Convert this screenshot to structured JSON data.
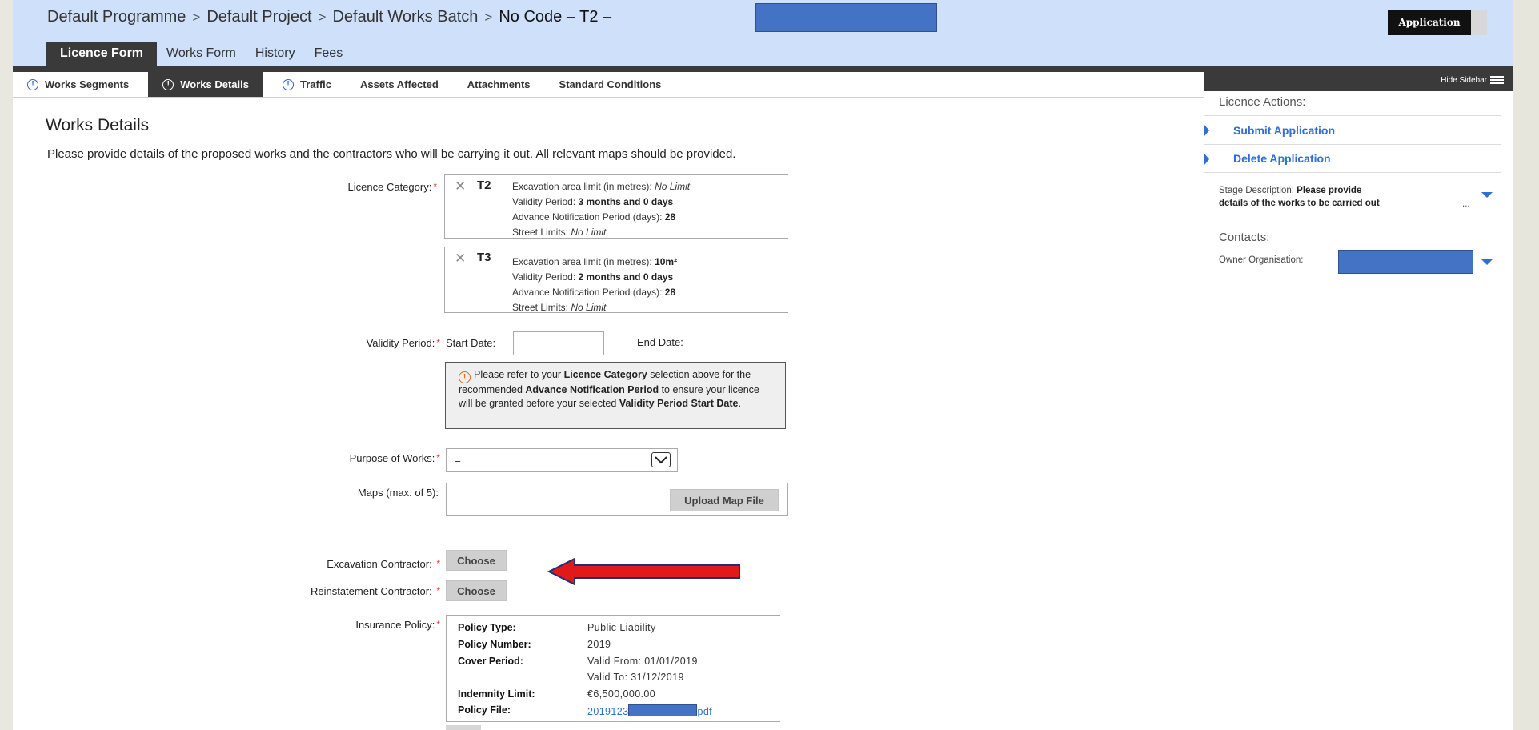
{
  "breadcrumb": {
    "items": [
      "Default Programme",
      "Default Project",
      "Default Works Batch"
    ],
    "current": "No Code – T2 –",
    "separator": ">"
  },
  "header": {
    "badge": "Application"
  },
  "main_tabs": [
    "Licence Form",
    "Works Form",
    "History",
    "Fees"
  ],
  "sub_tabs": [
    {
      "label": "Works Segments",
      "icon": "info-icon"
    },
    {
      "label": "Works Details",
      "icon": "info-icon"
    },
    {
      "label": "Traffic",
      "icon": "info-icon"
    },
    {
      "label": "Assets Affected"
    },
    {
      "label": "Attachments"
    },
    {
      "label": "Standard Conditions"
    }
  ],
  "page": {
    "title": "Works Details",
    "intro": "Please provide details of the proposed works and the contractors who will be carrying it out. All relevant maps should be provided."
  },
  "form": {
    "licence_category_label": "Licence Category:",
    "categories": [
      {
        "code": "T2",
        "excavation_label": "Excavation area limit (in metres):",
        "excavation_value": "No Limit",
        "validity_label": "Validity Period:",
        "validity_value": "3 months and 0 days",
        "advance_label": "Advance Notification Period (days):",
        "advance_value": "28",
        "street_label": "Street Limits:",
        "street_value": "No Limit"
      },
      {
        "code": "T3",
        "excavation_label": "Excavation area limit (in metres):",
        "excavation_value": "10m²",
        "validity_label": "Validity Period:",
        "validity_value": "2 months and 0 days",
        "advance_label": "Advance Notification Period (days):",
        "advance_value": "28",
        "street_label": "Street Limits:",
        "street_value": "No Limit"
      }
    ],
    "validity_label": "Validity Period:",
    "start_date_label": "Start Date:",
    "start_date_value": "",
    "end_date_label": "End Date:",
    "end_date_value": "–",
    "notice": {
      "p1": "Please refer to your",
      "b1": "Licence Category",
      "p2": "selection above for the recommended",
      "b2": "Advance Notification Period",
      "p3": "to ensure your licence will be granted before your selected",
      "b3": "Validity Period Start Date",
      "p4": "."
    },
    "purpose_label": "Purpose of Works:",
    "purpose_value": "–",
    "maps_label": "Maps (max. of 5):",
    "upload_button": "Upload Map File",
    "excavation_contractor_label": "Excavation Contractor:",
    "reinstatement_contractor_label": "Reinstatement Contractor:",
    "choose_button": "Choose",
    "insurance_label": "Insurance Policy:",
    "insurance": {
      "policy_type_label": "Policy Type:",
      "policy_type": "Public Liability",
      "policy_number_label": "Policy Number:",
      "policy_number": "2019",
      "cover_period_label": "Cover Period:",
      "valid_from": "Valid From: 01/01/2019",
      "valid_to": "Valid To: 31/12/2019",
      "indemnity_label": "Indemnity Limit:",
      "indemnity": "€6,500,000.00",
      "policy_file_label": "Policy File:",
      "policy_file_prefix": "2019123",
      "policy_file_suffix": "pdf"
    }
  },
  "sidebar": {
    "hide_label": "Hide Sidebar",
    "actions_heading": "Licence Actions:",
    "actions": [
      "Submit Application",
      "Delete Application"
    ],
    "stage_label": "Stage Description:",
    "stage_text_1": "Please provide",
    "stage_text_2": "details of the works to be carried out",
    "ellipsis": "...",
    "contacts_heading": "Contacts:",
    "owner_label": "Owner Organisation:"
  },
  "colors": {
    "header_bg": "#cfe0fb",
    "tab_dark": "#3a3a3a",
    "link": "#2f6fd0",
    "required": "#e0332c",
    "redaction": "#4472c4",
    "arrow": "#e01a1a"
  }
}
